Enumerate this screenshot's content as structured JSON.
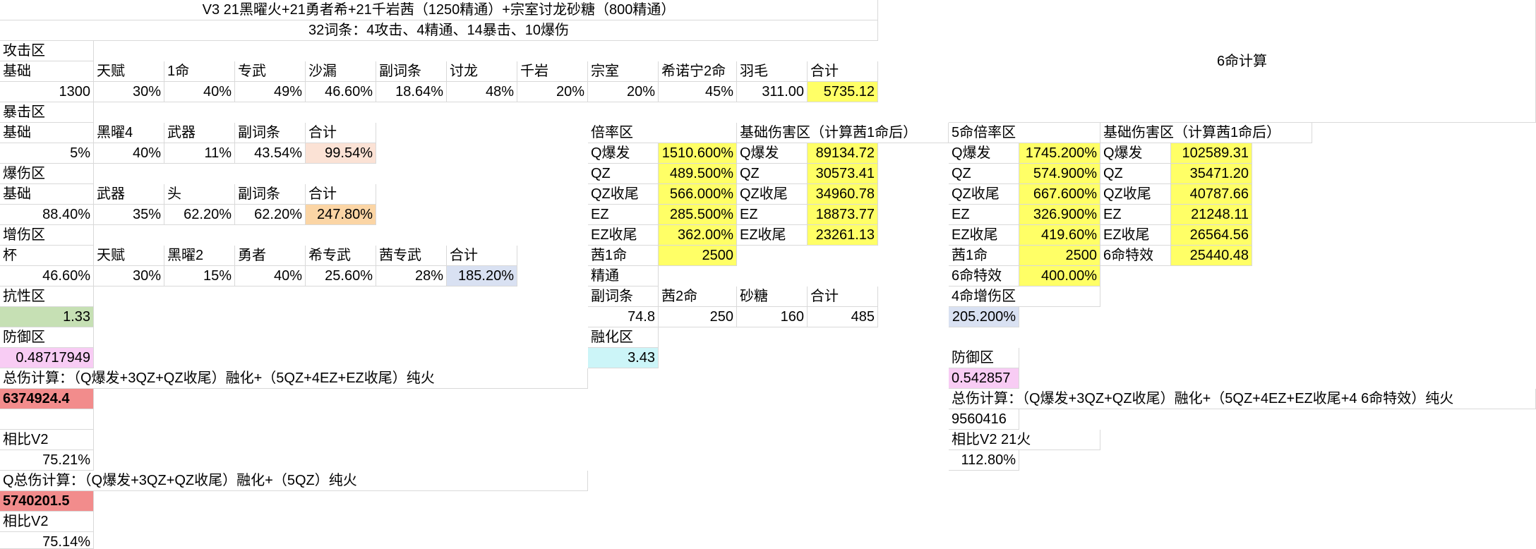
{
  "title": "V3 21黑曜火+21勇者希+21千岩茜（1250精通）+宗室讨龙砂糖（800精通）",
  "subtitle": "32词条：4攻击、4精通、14暴击、10爆伤",
  "sixCon": "6命计算",
  "attack": {
    "section": "攻击区",
    "headers": [
      "基础",
      "天赋",
      "1命",
      "专武",
      "沙漏",
      "副词条",
      "讨龙",
      "千岩",
      "宗室",
      "希诺宁2命",
      "羽毛",
      "合计"
    ],
    "values": [
      "1300",
      "30%",
      "40%",
      "49%",
      "46.60%",
      "18.64%",
      "48%",
      "20%",
      "20%",
      "45%",
      "311.00",
      "5735.12"
    ]
  },
  "crit": {
    "section": "暴击区",
    "headers": [
      "基础",
      "黑曜4",
      "武器",
      "副词条",
      "合计"
    ],
    "values": [
      "5%",
      "40%",
      "11%",
      "43.54%",
      "99.54%"
    ]
  },
  "critDmg": {
    "section": "爆伤区",
    "headers": [
      "基础",
      "武器",
      "头",
      "副词条",
      "合计"
    ],
    "values": [
      "88.40%",
      "35%",
      "62.20%",
      "62.20%",
      "247.80%"
    ]
  },
  "dmgBonus": {
    "section": "增伤区",
    "headers": [
      "杯",
      "天赋",
      "黑曜2",
      "勇者",
      "希专武",
      "茜专武",
      "合计"
    ],
    "values": [
      "46.60%",
      "30%",
      "15%",
      "40%",
      "25.60%",
      "28%",
      "185.20%"
    ]
  },
  "res": {
    "section": "抗性区",
    "value": "1.33"
  },
  "def": {
    "section": "防御区",
    "value": "0.48717949"
  },
  "total": {
    "label": "总伤计算：（Q爆发+3QZ+QZ收尾）融化+（5QZ+4EZ+EZ收尾）纯火",
    "value": "6374924.4",
    "cmpLabel": "相比V2",
    "cmpValue": "75.21%"
  },
  "qtotal": {
    "label": "Q总伤计算：（Q爆发+3QZ+QZ收尾）融化+（5QZ）纯火",
    "value": "5740201.5",
    "cmpLabel": "相比V2",
    "cmpValue": "75.14%"
  },
  "multiplier": {
    "section": "倍率区",
    "rows": [
      {
        "label": "Q爆发",
        "value": "1510.600%"
      },
      {
        "label": "QZ",
        "value": "489.500%"
      },
      {
        "label": "QZ收尾",
        "value": "566.000%"
      },
      {
        "label": "EZ",
        "value": "285.500%"
      },
      {
        "label": "EZ收尾",
        "value": "362.00%"
      },
      {
        "label": "茜1命",
        "value": "2500"
      }
    ],
    "emLabel": "精通"
  },
  "baseDmg": {
    "section": "基础伤害区（计算茜1命后）",
    "rows": [
      {
        "label": "Q爆发",
        "value": "89134.72"
      },
      {
        "label": "QZ",
        "value": "30573.41"
      },
      {
        "label": "QZ收尾",
        "value": "34960.78"
      },
      {
        "label": "EZ",
        "value": "18873.77"
      },
      {
        "label": "EZ收尾",
        "value": "23261.13"
      }
    ]
  },
  "em": {
    "headers": [
      "副词条",
      "茜2命",
      "砂糖",
      "合计"
    ],
    "values": [
      "74.8",
      "250",
      "160",
      "485"
    ]
  },
  "melt": {
    "section": "融化区",
    "value": "3.43"
  },
  "c5": {
    "section": "5命倍率区",
    "rows": [
      {
        "label": "Q爆发",
        "value": "1745.200%"
      },
      {
        "label": "QZ",
        "value": "574.900%"
      },
      {
        "label": "QZ收尾",
        "value": "667.600%"
      },
      {
        "label": "EZ",
        "value": "326.900%"
      },
      {
        "label": "EZ收尾",
        "value": "419.60%"
      },
      {
        "label": "茜1命",
        "value": "2500"
      },
      {
        "label": "6命特效",
        "value": "400.00%"
      }
    ],
    "c4Label": "4命增伤区",
    "c4Value": "205.200%",
    "defLabel": "防御区",
    "defValue": "0.542857"
  },
  "c6base": {
    "section": "基础伤害区（计算茜1命后）",
    "rows": [
      {
        "label": "Q爆发",
        "value": "102589.31"
      },
      {
        "label": "QZ",
        "value": "35471.20"
      },
      {
        "label": "QZ收尾",
        "value": "40787.66"
      },
      {
        "label": "EZ",
        "value": "21248.11"
      },
      {
        "label": "EZ收尾",
        "value": "26564.56"
      },
      {
        "label": "6命特效",
        "value": "25440.48"
      }
    ]
  },
  "c6total": {
    "label": "总伤计算：（Q爆发+3QZ+QZ收尾）融化+（5QZ+4EZ+EZ收尾+4 6命特效）纯火",
    "value": "9560416",
    "cmpLabel": "相比V2 21火",
    "cmpValue": "112.80%"
  }
}
